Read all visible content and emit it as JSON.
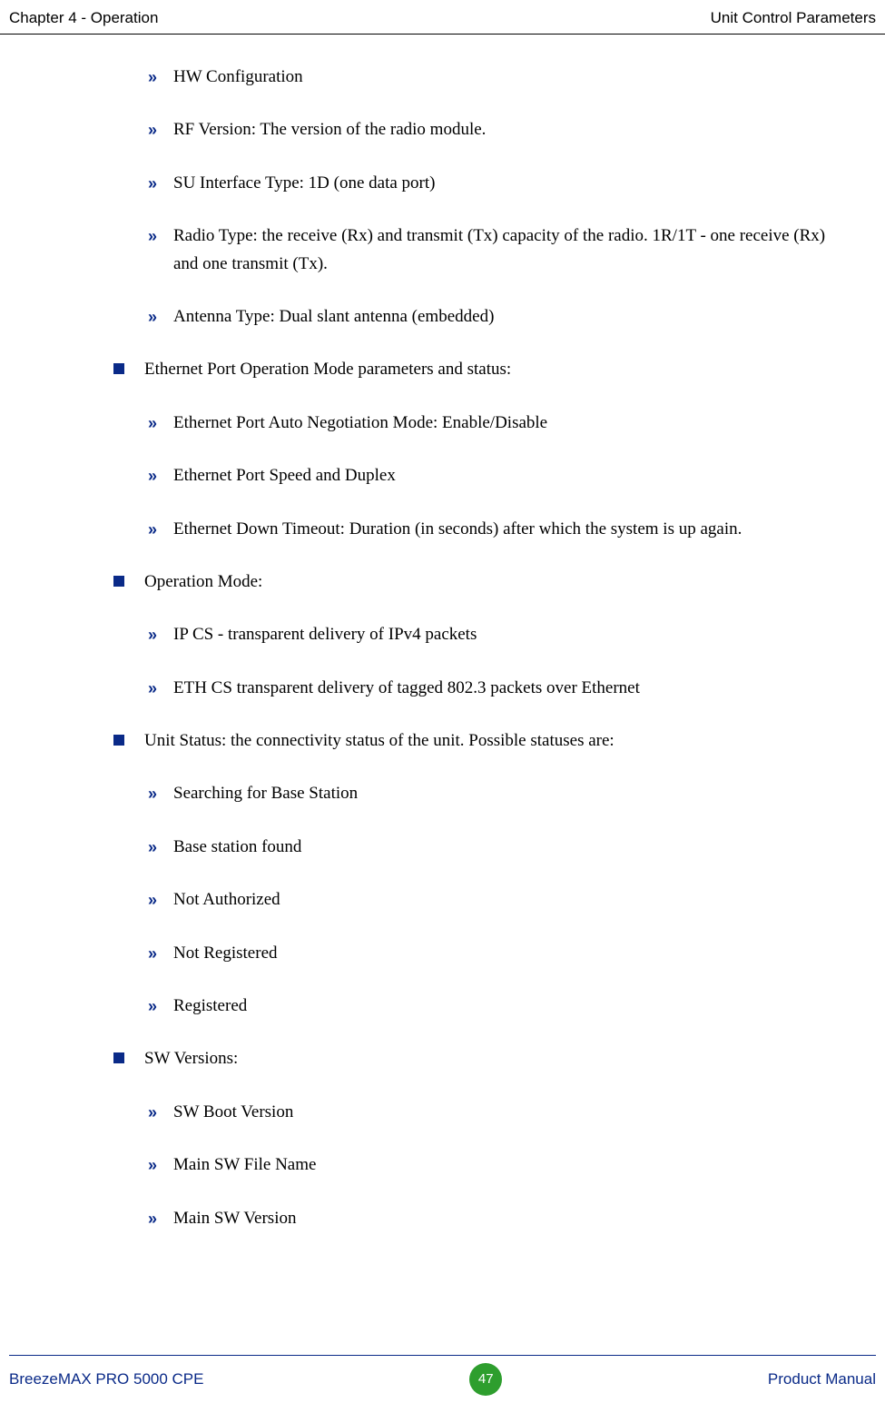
{
  "header": {
    "left": "Chapter 4 - Operation",
    "right": "Unit Control Parameters"
  },
  "intro_subitems": [
    "HW Configuration",
    "RF Version: The version of the radio module.",
    "SU Interface Type: 1D (one data port)",
    "Radio Type: the receive (Rx) and transmit (Tx) capacity of the radio. 1R/1T - one receive (Rx) and one transmit (Tx).",
    "Antenna Type: Dual slant antenna (embedded)"
  ],
  "sections": [
    {
      "title": "Ethernet Port Operation Mode parameters and status:",
      "items": [
        "Ethernet Port Auto Negotiation Mode: Enable/Disable",
        "Ethernet Port Speed and Duplex",
        "Ethernet Down Timeout: Duration (in seconds) after which the system is up again."
      ]
    },
    {
      "title": "Operation Mode:",
      "items": [
        "IP CS - transparent delivery of IPv4 packets",
        "ETH CS transparent delivery of tagged 802.3 packets over Ethernet"
      ]
    },
    {
      "title": "Unit Status: the connectivity status of the unit. Possible statuses are:",
      "items": [
        "Searching for Base Station",
        "Base station found",
        "Not Authorized",
        "Not Registered",
        "Registered"
      ]
    },
    {
      "title": "SW Versions:",
      "items": [
        "SW Boot Version",
        "Main SW File Name",
        "Main SW Version"
      ]
    }
  ],
  "footer": {
    "left": "BreezeMAX PRO 5000 CPE",
    "page": "47",
    "right": "Product Manual"
  }
}
